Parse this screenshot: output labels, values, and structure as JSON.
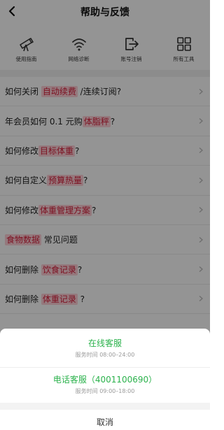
{
  "header": {
    "title": "帮助与反馈"
  },
  "tools": [
    {
      "label": "使用指南",
      "icon": "telescope-icon"
    },
    {
      "label": "网络诊断",
      "icon": "wifi-icon"
    },
    {
      "label": "账号注销",
      "icon": "logout-icon"
    },
    {
      "label": "所有工具",
      "icon": "grid-icon"
    }
  ],
  "faq": [
    {
      "pre": "如何关闭 ",
      "hl": "自动续费",
      "post": " /连续订阅?"
    },
    {
      "pre": "年会员如何 0.1 元购",
      "hl": "体脂秤",
      "post": "?"
    },
    {
      "pre": "如何修改",
      "hl": "目标体重",
      "post": "?"
    },
    {
      "pre": "如何自定义",
      "hl": "预算热量",
      "post": "?"
    },
    {
      "pre": "如何修改",
      "hl": "体重管理方案",
      "post": "?"
    },
    {
      "pre": "",
      "hl": "食物数据",
      "post": " 常见问题"
    },
    {
      "pre": "如何删除 ",
      "hl": "饮食记录",
      "post": "?"
    },
    {
      "pre": "如何删除 ",
      "hl": "体重记录",
      "post": " ?"
    }
  ],
  "sheet": {
    "online": {
      "title": "在线客服",
      "hours": "服务时间 08:00–24:00"
    },
    "phone": {
      "title": "电话客服（4001100690）",
      "hours": "服务时间 09:00–18:00"
    },
    "cancel": "取消"
  },
  "colors": {
    "accent_green": "#2bb24c",
    "highlight_text": "#d81e3a",
    "highlight_bg": "#ffd0d8"
  }
}
